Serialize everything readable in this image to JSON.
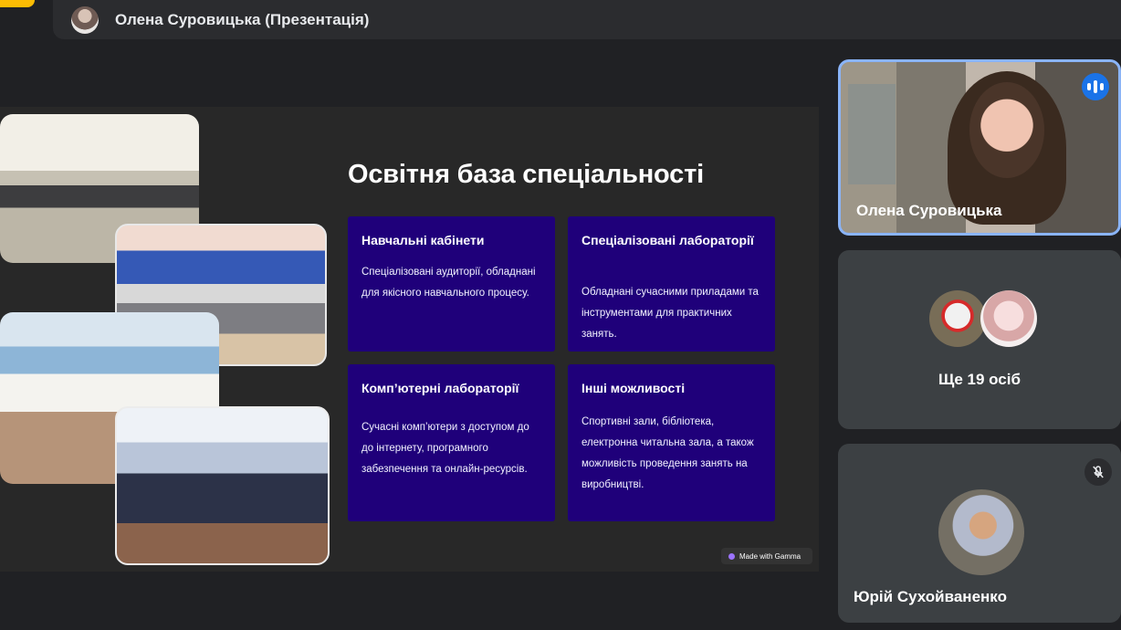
{
  "meeting": {
    "presenter_title": "Олена Суровицька (Презентація)"
  },
  "slide": {
    "title": "Освітня база спеціальності",
    "cards": [
      {
        "title": "Навчальні кабінети",
        "text": "Спеціалізовані аудиторії, обладнані для якісного навчального процесу."
      },
      {
        "title": "Спеціалізовані лабораторії",
        "text": "Обладнані сучасними приладами та інструментами для практичних занять."
      },
      {
        "title": "Комп’ютерні лабораторії",
        "text": "Сучасні комп’ютери з доступом до до інтернету, програмного забезпечення та онлайн-ресурсів."
      },
      {
        "title": "Інші можливості",
        "text": "Спортивні зали, бібліотека, електронна читальна зала, а також можливість проведення занять на виробництві."
      }
    ],
    "badge": "Made with Gamma"
  },
  "participants": {
    "active_speaker": "Олена Суровицька",
    "more_count": "Ще 19 осіб",
    "muted_participant": "Юрій Сухойваненко"
  },
  "colors": {
    "background": "#202124",
    "card": "#1f007a",
    "speaker_border": "#8ab4f8",
    "speaking_indicator": "#1a73e8"
  }
}
